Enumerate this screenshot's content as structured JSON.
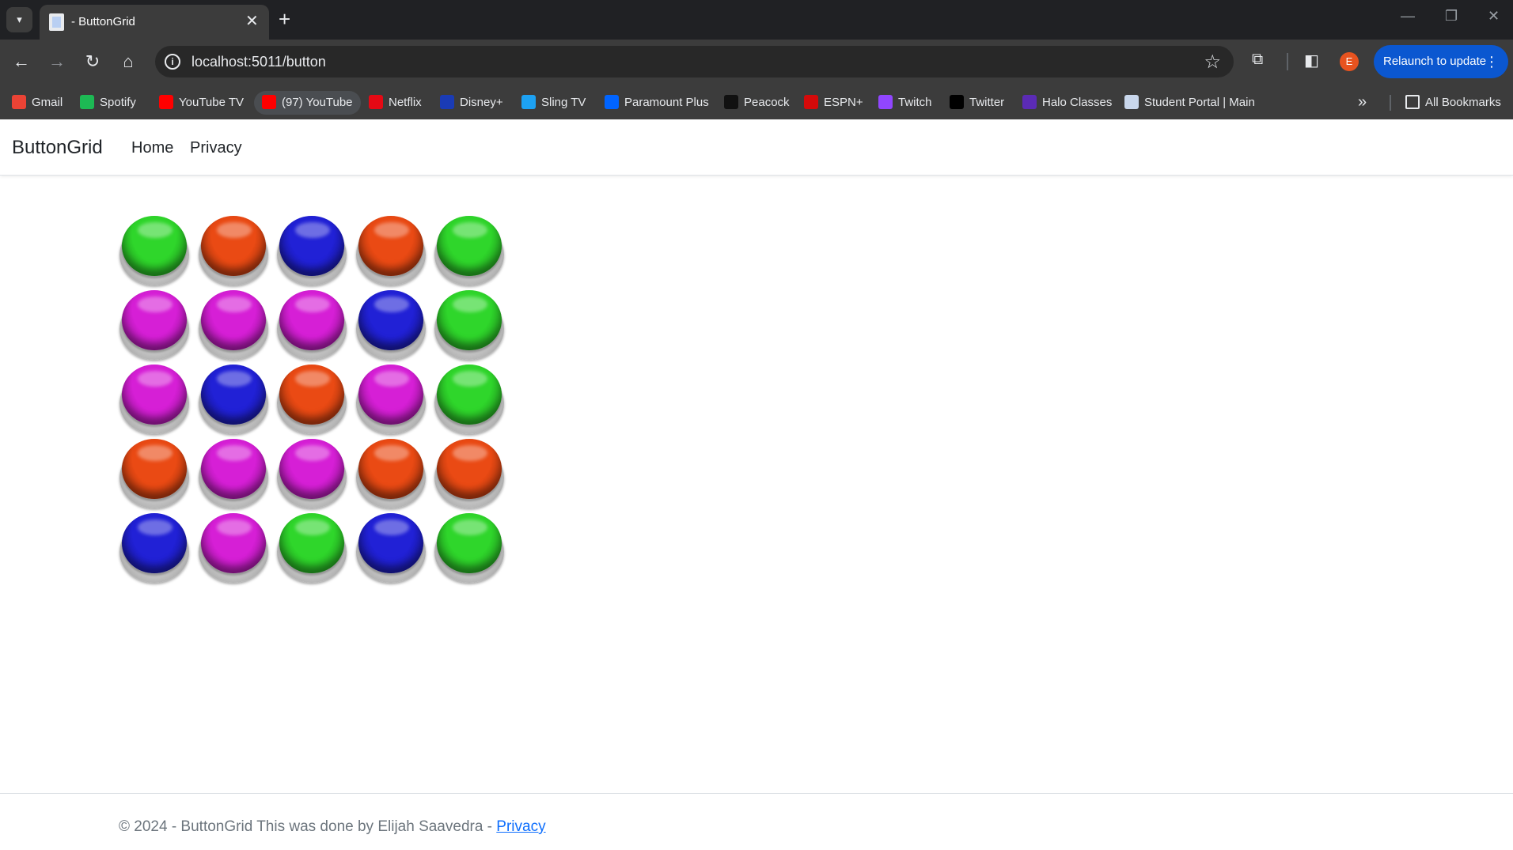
{
  "browser": {
    "tab_title": "- ButtonGrid",
    "url": "localhost:5011/button",
    "relaunch_label": "Relaunch to update",
    "avatar_letter": "E",
    "bookmarks": [
      {
        "label": "Gmail",
        "color": "#ea4335"
      },
      {
        "label": "Spotify",
        "color": "#1db954"
      },
      {
        "label": "YouTube TV",
        "color": "#ff0000"
      },
      {
        "label": "(97) YouTube",
        "color": "#ff0000"
      },
      {
        "label": "Netflix",
        "color": "#e50914"
      },
      {
        "label": "Disney+",
        "color": "#1a3bb5"
      },
      {
        "label": "Sling TV",
        "color": "#1da1f2"
      },
      {
        "label": "Paramount Plus",
        "color": "#0064ff"
      },
      {
        "label": "Peacock",
        "color": "#111111"
      },
      {
        "label": "ESPN+",
        "color": "#d50a0a"
      },
      {
        "label": "Twitch",
        "color": "#9146ff"
      },
      {
        "label": "Twitter",
        "color": "#000000"
      },
      {
        "label": "Halo Classes",
        "color": "#5b2bb5"
      },
      {
        "label": "Student Portal | Main",
        "color": "#c9d7ec"
      }
    ],
    "all_bookmarks_label": "All Bookmarks"
  },
  "navbar": {
    "brand": "ButtonGrid",
    "links": [
      "Home",
      "Privacy"
    ]
  },
  "grid": {
    "colors": {
      "green": "#2fd62b",
      "orange": "#ea4a14",
      "blue": "#2121d6",
      "magenta": "#d61fd6"
    },
    "rows": [
      [
        "green",
        "orange",
        "blue",
        "orange",
        "green"
      ],
      [
        "magenta",
        "magenta",
        "magenta",
        "blue",
        "green"
      ],
      [
        "magenta",
        "blue",
        "orange",
        "magenta",
        "green"
      ],
      [
        "orange",
        "magenta",
        "magenta",
        "orange",
        "orange"
      ],
      [
        "blue",
        "magenta",
        "green",
        "blue",
        "green"
      ]
    ]
  },
  "footer": {
    "text": "© 2024 - ButtonGrid This was done by Elijah Saavedra - ",
    "link": "Privacy"
  }
}
